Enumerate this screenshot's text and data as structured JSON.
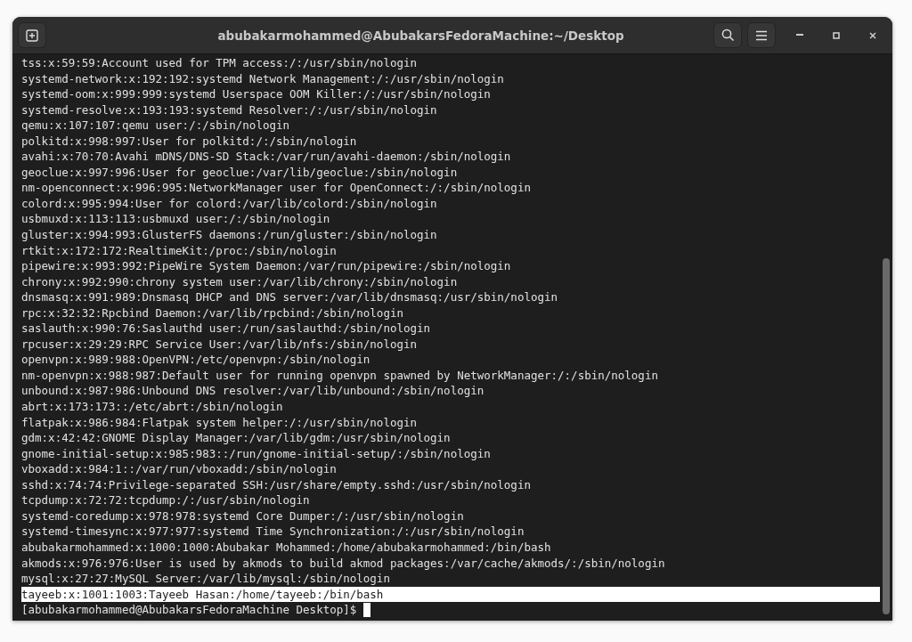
{
  "window": {
    "title": "abubakarmohammed@AbubakarsFedoraMachine:~/Desktop"
  },
  "terminal": {
    "lines": [
      {
        "text": "tss:x:59:59:Account used for TPM access:/:/usr/sbin/nologin",
        "selected": false
      },
      {
        "text": "systemd-network:x:192:192:systemd Network Management:/:/usr/sbin/nologin",
        "selected": false
      },
      {
        "text": "systemd-oom:x:999:999:systemd Userspace OOM Killer:/:/usr/sbin/nologin",
        "selected": false
      },
      {
        "text": "systemd-resolve:x:193:193:systemd Resolver:/:/usr/sbin/nologin",
        "selected": false
      },
      {
        "text": "qemu:x:107:107:qemu user:/:/sbin/nologin",
        "selected": false
      },
      {
        "text": "polkitd:x:998:997:User for polkitd:/:/sbin/nologin",
        "selected": false
      },
      {
        "text": "avahi:x:70:70:Avahi mDNS/DNS-SD Stack:/var/run/avahi-daemon:/sbin/nologin",
        "selected": false
      },
      {
        "text": "geoclue:x:997:996:User for geoclue:/var/lib/geoclue:/sbin/nologin",
        "selected": false
      },
      {
        "text": "nm-openconnect:x:996:995:NetworkManager user for OpenConnect:/:/sbin/nologin",
        "selected": false
      },
      {
        "text": "colord:x:995:994:User for colord:/var/lib/colord:/sbin/nologin",
        "selected": false
      },
      {
        "text": "usbmuxd:x:113:113:usbmuxd user:/:/sbin/nologin",
        "selected": false
      },
      {
        "text": "gluster:x:994:993:GlusterFS daemons:/run/gluster:/sbin/nologin",
        "selected": false
      },
      {
        "text": "rtkit:x:172:172:RealtimeKit:/proc:/sbin/nologin",
        "selected": false
      },
      {
        "text": "pipewire:x:993:992:PipeWire System Daemon:/var/run/pipewire:/sbin/nologin",
        "selected": false
      },
      {
        "text": "chrony:x:992:990:chrony system user:/var/lib/chrony:/sbin/nologin",
        "selected": false
      },
      {
        "text": "dnsmasq:x:991:989:Dnsmasq DHCP and DNS server:/var/lib/dnsmasq:/usr/sbin/nologin",
        "selected": false
      },
      {
        "text": "rpc:x:32:32:Rpcbind Daemon:/var/lib/rpcbind:/sbin/nologin",
        "selected": false
      },
      {
        "text": "saslauth:x:990:76:Saslauthd user:/run/saslauthd:/sbin/nologin",
        "selected": false
      },
      {
        "text": "rpcuser:x:29:29:RPC Service User:/var/lib/nfs:/sbin/nologin",
        "selected": false
      },
      {
        "text": "openvpn:x:989:988:OpenVPN:/etc/openvpn:/sbin/nologin",
        "selected": false
      },
      {
        "text": "nm-openvpn:x:988:987:Default user for running openvpn spawned by NetworkManager:/:/sbin/nologin",
        "selected": false
      },
      {
        "text": "unbound:x:987:986:Unbound DNS resolver:/var/lib/unbound:/sbin/nologin",
        "selected": false
      },
      {
        "text": "abrt:x:173:173::/etc/abrt:/sbin/nologin",
        "selected": false
      },
      {
        "text": "flatpak:x:986:984:Flatpak system helper:/:/usr/sbin/nologin",
        "selected": false
      },
      {
        "text": "gdm:x:42:42:GNOME Display Manager:/var/lib/gdm:/usr/sbin/nologin",
        "selected": false
      },
      {
        "text": "gnome-initial-setup:x:985:983::/run/gnome-initial-setup/:/sbin/nologin",
        "selected": false
      },
      {
        "text": "vboxadd:x:984:1::/var/run/vboxadd:/sbin/nologin",
        "selected": false
      },
      {
        "text": "sshd:x:74:74:Privilege-separated SSH:/usr/share/empty.sshd:/usr/sbin/nologin",
        "selected": false
      },
      {
        "text": "tcpdump:x:72:72:tcpdump:/:/usr/sbin/nologin",
        "selected": false
      },
      {
        "text": "systemd-coredump:x:978:978:systemd Core Dumper:/:/usr/sbin/nologin",
        "selected": false
      },
      {
        "text": "systemd-timesync:x:977:977:systemd Time Synchronization:/:/usr/sbin/nologin",
        "selected": false
      },
      {
        "text": "abubakarmohammed:x:1000:1000:Abubakar Mohammed:/home/abubakarmohammed:/bin/bash",
        "selected": false
      },
      {
        "text": "akmods:x:976:976:User is used by akmods to build akmod packages:/var/cache/akmods/:/sbin/nologin",
        "selected": false
      },
      {
        "text": "mysql:x:27:27:MySQL Server:/var/lib/mysql:/sbin/nologin",
        "selected": false
      },
      {
        "text": "tayeeb:x:1001:1003:Tayeeb Hasan:/home/tayeeb:/bin/bash",
        "selected": true
      }
    ],
    "prompt": "[abubakarmohammed@AbubakarsFedoraMachine Desktop]$"
  }
}
